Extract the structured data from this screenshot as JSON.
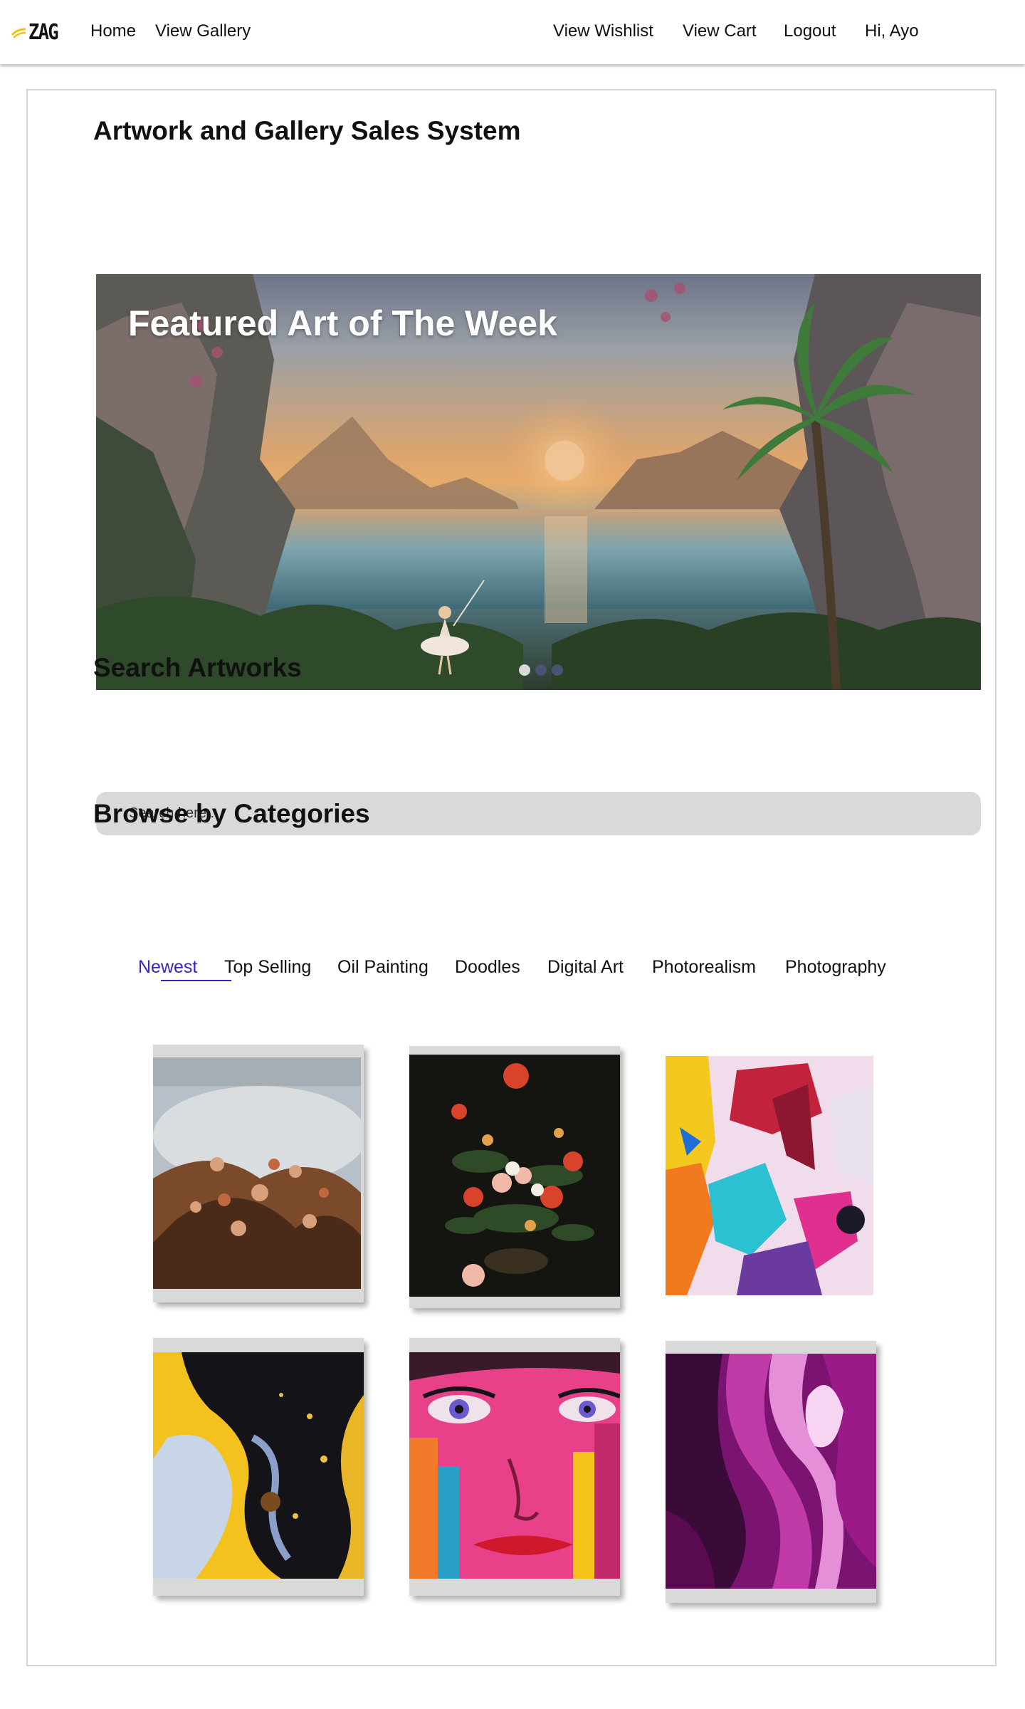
{
  "nav": {
    "logo_text": "ZAG",
    "home": "Home",
    "gallery": "View Gallery",
    "wishlist": "View Wishlist",
    "cart": "View Cart",
    "logout": "Logout",
    "greeting": "Hi, Ayo"
  },
  "page_title": "Artwork and Gallery Sales System",
  "hero": {
    "title": "Featured Art of The Week",
    "slides": 3,
    "active_slide": 1
  },
  "search": {
    "heading": "Search Artworks",
    "placeholder": "Search here..."
  },
  "categories": {
    "heading": "Browse by Categories",
    "items": [
      "Newest",
      "Top Selling",
      "Oil Painting",
      "Doodles",
      "Digital Art",
      "Photorealism",
      "Photography"
    ],
    "active": "Newest"
  },
  "colors": {
    "accent": "#3b22c8",
    "search_bg": "#d9d9d9",
    "logo_accent": "#f2c21b",
    "dot": "#4a5472"
  },
  "gallery": {
    "artworks": [
      {
        "name": "baroque-ceiling-painting"
      },
      {
        "name": "dark-floral-still-life"
      },
      {
        "name": "colorful-abstract-palette-knife"
      },
      {
        "name": "black-yellow-fluid-pour"
      },
      {
        "name": "pop-art-face-portrait"
      },
      {
        "name": "purple-marble-swirl"
      }
    ]
  }
}
